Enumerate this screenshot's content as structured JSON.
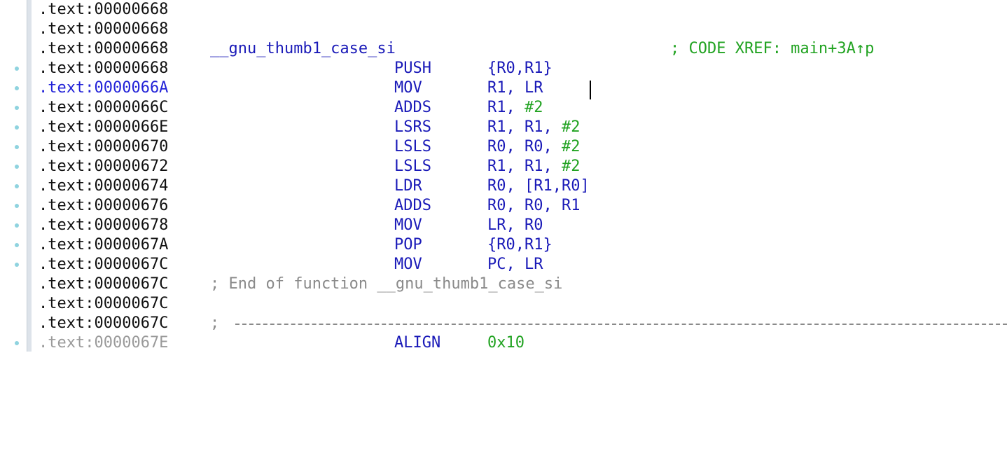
{
  "window": {
    "title": ""
  },
  "colors": {
    "address": "#101010",
    "address_highlight": "#2222d8",
    "keyword": "#1a1ab8",
    "number": "#22a322",
    "comment": "#8a8a8a",
    "gutter_dot": "#8fd3df"
  },
  "listing": {
    "lines": [
      {
        "addr": ".text:00000668"
      },
      {
        "addr": ".text:00000668"
      },
      {
        "addr": ".text:00000668",
        "label": "__gnu_thumb1_case_si",
        "xref": "; CODE XREF: main+3A↑p"
      },
      {
        "addr": ".text:00000668",
        "mnemonic": "PUSH",
        "operands": "{R0,R1}"
      },
      {
        "addr": ".text:0000066A",
        "mnemonic": "MOV",
        "operands": "R1, LR"
      },
      {
        "addr": ".text:0000066C",
        "mnemonic": "ADDS",
        "operands": "R1, ",
        "operand_num": "#2"
      },
      {
        "addr": ".text:0000066E",
        "mnemonic": "LSRS",
        "operands": "R1, R1, ",
        "operand_num": "#2"
      },
      {
        "addr": ".text:00000670",
        "mnemonic": "LSLS",
        "operands": "R0, R0, ",
        "operand_num": "#2"
      },
      {
        "addr": ".text:00000672",
        "mnemonic": "LSLS",
        "operands": "R1, R1, ",
        "operand_num": "#2"
      },
      {
        "addr": ".text:00000674",
        "mnemonic": "LDR",
        "operands": "R0, [R1,R0]"
      },
      {
        "addr": ".text:00000676",
        "mnemonic": "ADDS",
        "operands": "R0, R0, R1"
      },
      {
        "addr": ".text:00000678",
        "mnemonic": "MOV",
        "operands": "LR, R0"
      },
      {
        "addr": ".text:0000067A",
        "mnemonic": "POP",
        "operands": "{R0,R1}"
      },
      {
        "addr": ".text:0000067C",
        "mnemonic": "MOV",
        "operands": "PC, LR"
      },
      {
        "addr": ".text:0000067C",
        "comment": "; End of function __gnu_thumb1_case_si"
      },
      {
        "addr": ".text:0000067C"
      },
      {
        "addr": ".text:0000067C",
        "comment": ";"
      },
      {
        "addr": ".text:0000067E",
        "mnemonic": "ALIGN",
        "operand_num": "0x10"
      }
    ]
  }
}
